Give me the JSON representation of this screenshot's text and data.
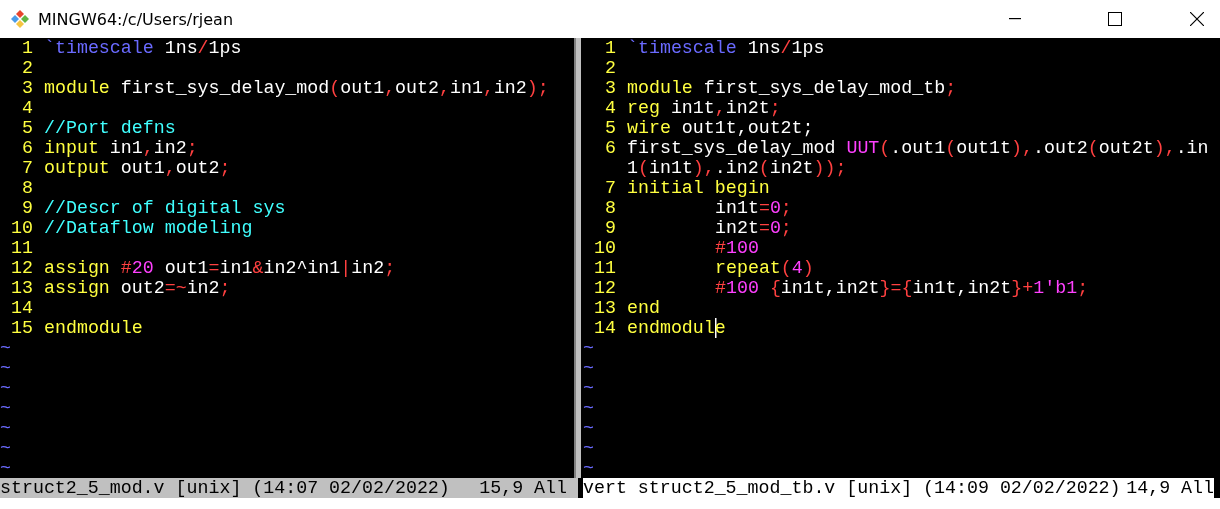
{
  "window": {
    "title": "MINGW64:/c/Users/rjean"
  },
  "panes": [
    {
      "rows": [
        {
          "number": "1",
          "segments": [
            {
              "kind": "directive",
              "text": "`timescale"
            },
            {
              "kind": "plain",
              "text": " 1ns"
            },
            {
              "kind": "operator",
              "text": "/"
            },
            {
              "kind": "plain",
              "text": "1ps"
            }
          ]
        },
        {
          "number": "2"
        },
        {
          "number": "3",
          "segments": [
            {
              "kind": "keyword",
              "text": "module"
            },
            {
              "kind": "plain",
              "text": " first_sys_delay_mod"
            },
            {
              "kind": "operator",
              "text": "("
            },
            {
              "kind": "plain",
              "text": "out1"
            },
            {
              "kind": "operator",
              "text": ","
            },
            {
              "kind": "plain",
              "text": "out2"
            },
            {
              "kind": "operator",
              "text": ","
            },
            {
              "kind": "plain",
              "text": "in1"
            },
            {
              "kind": "operator",
              "text": ","
            },
            {
              "kind": "plain",
              "text": "in2"
            },
            {
              "kind": "operator",
              "text": ");"
            }
          ]
        },
        {
          "number": "4"
        },
        {
          "number": "5",
          "segments": [
            {
              "kind": "comment",
              "text": "//Port defns"
            }
          ]
        },
        {
          "number": "6",
          "segments": [
            {
              "kind": "keyword",
              "text": "input"
            },
            {
              "kind": "plain",
              "text": " in1"
            },
            {
              "kind": "operator",
              "text": ","
            },
            {
              "kind": "plain",
              "text": "in2"
            },
            {
              "kind": "operator",
              "text": ";"
            }
          ]
        },
        {
          "number": "7",
          "segments": [
            {
              "kind": "keyword",
              "text": "output"
            },
            {
              "kind": "plain",
              "text": " out1"
            },
            {
              "kind": "operator",
              "text": ","
            },
            {
              "kind": "plain",
              "text": "out2"
            },
            {
              "kind": "operator",
              "text": ";"
            }
          ]
        },
        {
          "number": "8"
        },
        {
          "number": "9",
          "segments": [
            {
              "kind": "comment",
              "text": "//Descr of digital sys"
            }
          ]
        },
        {
          "number": "10",
          "segments": [
            {
              "kind": "comment",
              "text": "//Dataflow modeling"
            }
          ]
        },
        {
          "number": "11"
        },
        {
          "number": "12",
          "segments": [
            {
              "kind": "keyword",
              "text": "assign "
            },
            {
              "kind": "operator",
              "text": "#"
            },
            {
              "kind": "number",
              "text": "20"
            },
            {
              "kind": "plain",
              "text": " out1"
            },
            {
              "kind": "operator",
              "text": "="
            },
            {
              "kind": "plain",
              "text": "in1"
            },
            {
              "kind": "operator",
              "text": "&"
            },
            {
              "kind": "plain",
              "text": "in2^in1"
            },
            {
              "kind": "operator",
              "text": "|"
            },
            {
              "kind": "plain",
              "text": "in2"
            },
            {
              "kind": "operator",
              "text": ";"
            }
          ]
        },
        {
          "number": "13",
          "segments": [
            {
              "kind": "keyword",
              "text": "assign"
            },
            {
              "kind": "plain",
              "text": " out2"
            },
            {
              "kind": "operator",
              "text": "=~"
            },
            {
              "kind": "plain",
              "text": "in2"
            },
            {
              "kind": "operator",
              "text": ";"
            }
          ]
        },
        {
          "number": "14"
        },
        {
          "number": "15",
          "segments": [
            {
              "kind": "keyword",
              "text": "endmodule"
            }
          ]
        }
      ],
      "filler": [
        "~",
        "~",
        "~",
        "~",
        "~",
        "~",
        "~"
      ],
      "status": {
        "active": false,
        "text": "struct2_5_mod.v [unix] (14:07 02/02/2022)",
        "position": "15,9 All"
      }
    },
    {
      "rows": [
        {
          "number": "1",
          "segments": [
            {
              "kind": "directive",
              "text": "`timescale"
            },
            {
              "kind": "plain",
              "text": " 1ns"
            },
            {
              "kind": "operator",
              "text": "/"
            },
            {
              "kind": "plain",
              "text": "1ps"
            }
          ]
        },
        {
          "number": "2"
        },
        {
          "number": "3",
          "segments": [
            {
              "kind": "keyword",
              "text": "module"
            },
            {
              "kind": "plain",
              "text": " first_sys_delay_mod_tb"
            },
            {
              "kind": "operator",
              "text": ";"
            }
          ]
        },
        {
          "number": "4",
          "segments": [
            {
              "kind": "keyword",
              "text": "reg"
            },
            {
              "kind": "plain",
              "text": " in1t"
            },
            {
              "kind": "operator",
              "text": ","
            },
            {
              "kind": "plain",
              "text": "in2t"
            },
            {
              "kind": "operator",
              "text": ";"
            }
          ]
        },
        {
          "number": "5",
          "segments": [
            {
              "kind": "keyword",
              "text": "wire"
            },
            {
              "kind": "plain",
              "text": " out1t,out2t;"
            }
          ]
        },
        {
          "number": "6",
          "segments": [
            {
              "kind": "plain",
              "text": "first_sys_delay_mod "
            },
            {
              "kind": "number",
              "text": "UUT"
            },
            {
              "kind": "operator",
              "text": "("
            },
            {
              "kind": "plain",
              "text": ".out1"
            },
            {
              "kind": "operator",
              "text": "("
            },
            {
              "kind": "plain",
              "text": "out1t"
            },
            {
              "kind": "operator",
              "text": "),"
            },
            {
              "kind": "plain",
              "text": ".out2"
            },
            {
              "kind": "operator",
              "text": "("
            },
            {
              "kind": "plain",
              "text": "out2t"
            },
            {
              "kind": "operator",
              "text": "),"
            },
            {
              "kind": "plain",
              "text": ".in"
            }
          ]
        },
        {
          "segments": [
            {
              "kind": "plain",
              "text": "1"
            },
            {
              "kind": "operator",
              "text": "("
            },
            {
              "kind": "plain",
              "text": "in1t"
            },
            {
              "kind": "operator",
              "text": "),"
            },
            {
              "kind": "plain",
              "text": ".in2"
            },
            {
              "kind": "operator",
              "text": "("
            },
            {
              "kind": "plain",
              "text": "in2t"
            },
            {
              "kind": "operator",
              "text": "));"
            }
          ]
        },
        {
          "number": "7",
          "segments": [
            {
              "kind": "keyword",
              "text": "initial begin"
            }
          ]
        },
        {
          "number": "8",
          "indented": true,
          "segments": [
            {
              "kind": "plain",
              "text": "in1t"
            },
            {
              "kind": "operator",
              "text": "="
            },
            {
              "kind": "number",
              "text": "0"
            },
            {
              "kind": "operator",
              "text": ";"
            }
          ]
        },
        {
          "number": "9",
          "indented": true,
          "segments": [
            {
              "kind": "plain",
              "text": "in2t"
            },
            {
              "kind": "operator",
              "text": "="
            },
            {
              "kind": "number",
              "text": "0"
            },
            {
              "kind": "operator",
              "text": ";"
            }
          ]
        },
        {
          "number": "10",
          "indented": true,
          "segments": [
            {
              "kind": "operator",
              "text": "#"
            },
            {
              "kind": "number",
              "text": "100"
            }
          ]
        },
        {
          "number": "11",
          "indented": true,
          "segments": [
            {
              "kind": "keyword",
              "text": "repeat"
            },
            {
              "kind": "operator",
              "text": "("
            },
            {
              "kind": "number",
              "text": "4"
            },
            {
              "kind": "operator",
              "text": ")"
            }
          ]
        },
        {
          "number": "12",
          "indented": true,
          "segments": [
            {
              "kind": "operator",
              "text": "#"
            },
            {
              "kind": "number",
              "text": "100 "
            },
            {
              "kind": "operator",
              "text": "{"
            },
            {
              "kind": "plain",
              "text": "in1t,in2t"
            },
            {
              "kind": "operator",
              "text": "}={"
            },
            {
              "kind": "plain",
              "text": "in1t,in2t"
            },
            {
              "kind": "operator",
              "text": "}+"
            },
            {
              "kind": "number",
              "text": "1'b1"
            },
            {
              "kind": "operator",
              "text": ";"
            }
          ]
        },
        {
          "number": "13",
          "segments": [
            {
              "kind": "keyword",
              "text": "end"
            }
          ]
        },
        {
          "number": "14",
          "segments": [
            {
              "kind": "keyword",
              "text": "endmodul"
            },
            {
              "kind": "keyword",
              "text": "e",
              "cursor": true
            }
          ]
        }
      ],
      "filler": [
        "~",
        "~",
        "~",
        "~",
        "~",
        "~",
        "~"
      ],
      "status": {
        "active": true,
        "text": "vert struct2_5_mod_tb.v [unix] (14:09 02/02/2022)",
        "position": "14,9 All"
      }
    }
  ]
}
